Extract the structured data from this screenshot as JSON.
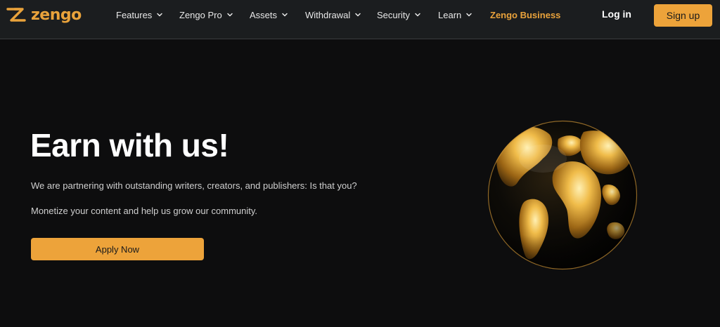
{
  "brand": {
    "name": "zengo",
    "color": "#e9a23b"
  },
  "nav": {
    "items": [
      {
        "label": "Features",
        "dropdown": true
      },
      {
        "label": "Zengo Pro",
        "dropdown": true
      },
      {
        "label": "Assets",
        "dropdown": true
      },
      {
        "label": "Withdrawal",
        "dropdown": true
      },
      {
        "label": "Security",
        "dropdown": true
      },
      {
        "label": "Learn",
        "dropdown": true
      },
      {
        "label": "Zengo Business",
        "dropdown": false,
        "highlight": "#e9a23b"
      }
    ],
    "login_label": "Log in",
    "signup_label": "Sign up"
  },
  "hero": {
    "title": "Earn with us!",
    "paragraph_1": "We are partnering with outstanding writers, creators, and publishers: Is that you?",
    "paragraph_2": "Monetize your content and help us grow our community.",
    "cta_label": "Apply Now"
  },
  "colors": {
    "accent": "#eda33a",
    "background": "#0d0d0e",
    "navbar": "#1b1d1f"
  },
  "icons": {
    "logo": "zengo-logo-icon",
    "dropdown": "chevron-down-icon",
    "hero_image": "golden-globe-icon"
  }
}
